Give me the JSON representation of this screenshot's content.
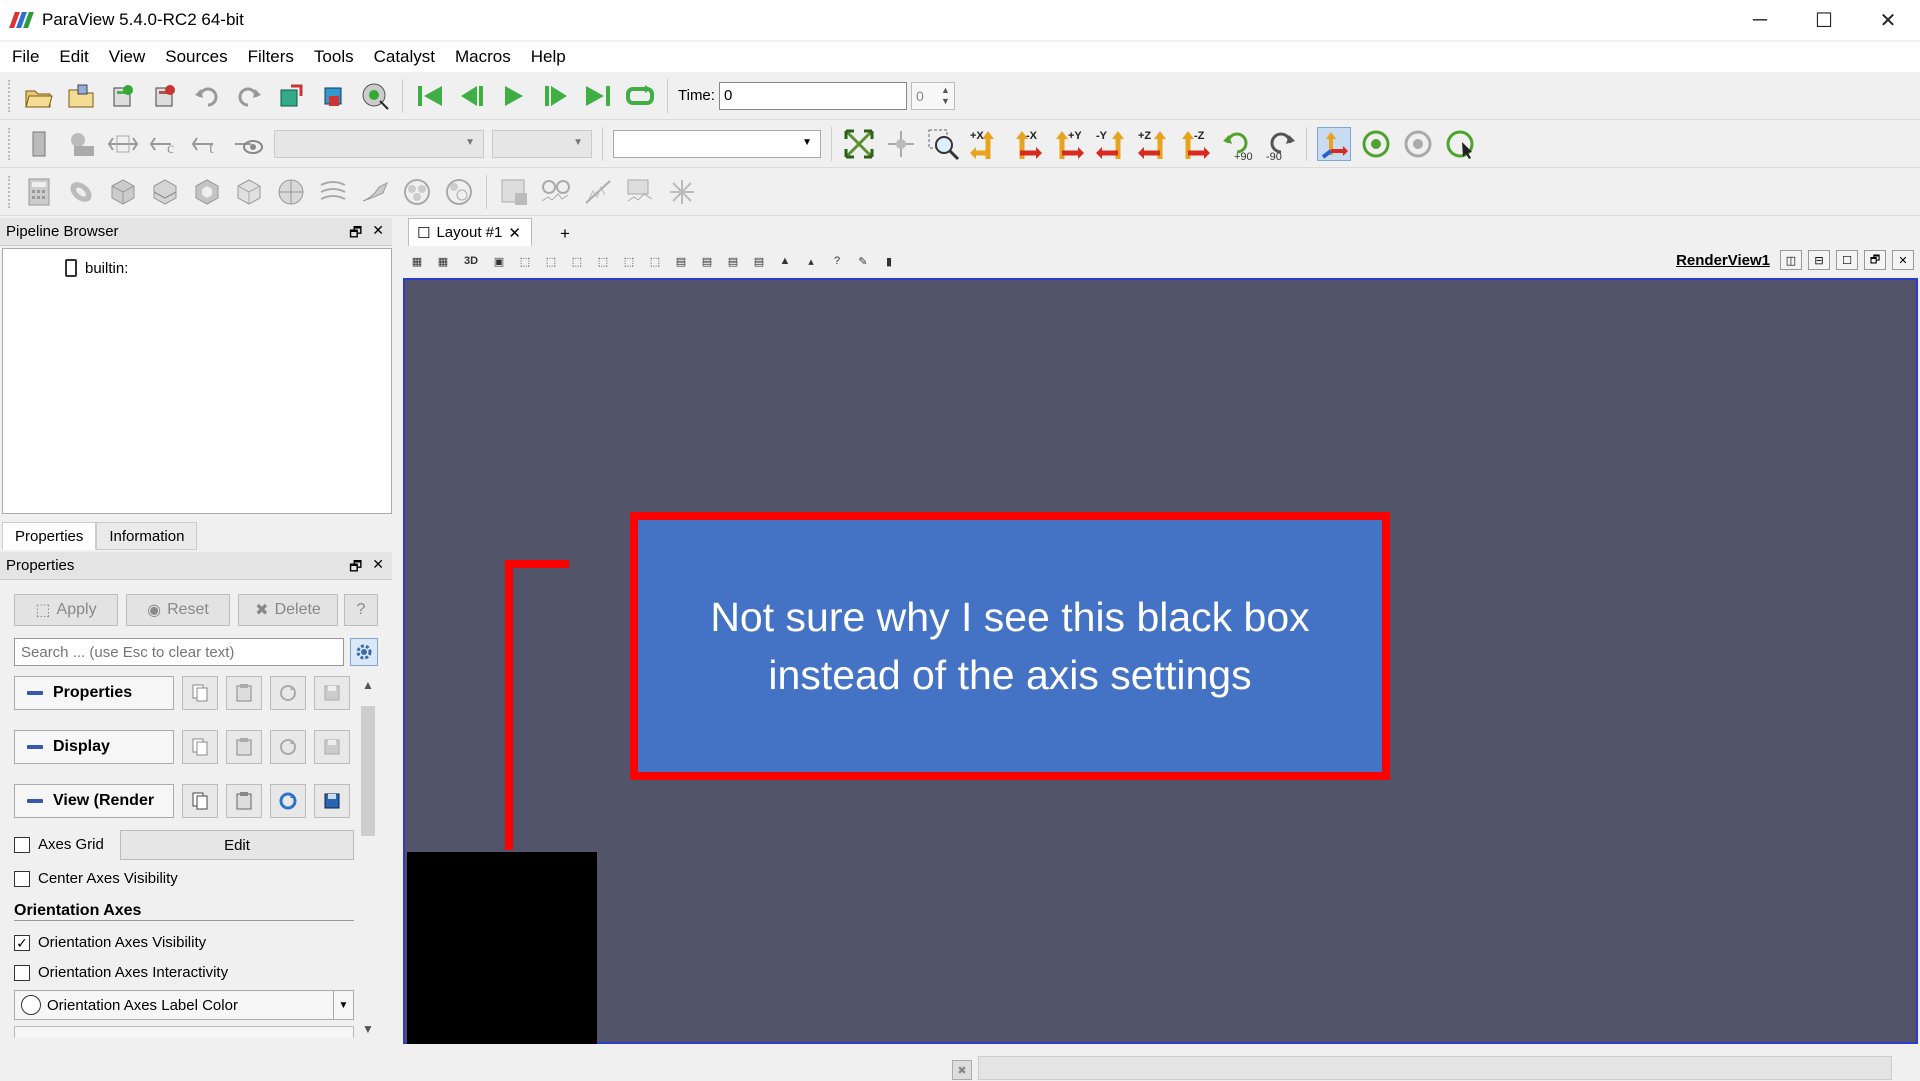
{
  "window": {
    "title": "ParaView 5.4.0-RC2 64-bit",
    "minimize": "─",
    "maximize": "☐",
    "close": "✕"
  },
  "menu": [
    "File",
    "Edit",
    "View",
    "Sources",
    "Filters",
    "Tools",
    "Catalyst",
    "Macros",
    "Help"
  ],
  "toolbar": {
    "time_label": "Time:",
    "time_value": "0",
    "timestep_value": "0",
    "axis_buttons": [
      "+X",
      "-X",
      "+Y",
      "-Y",
      "+Z",
      "-Z"
    ],
    "rotate_pos": "+90",
    "rotate_neg": "-90"
  },
  "pipeline_browser": {
    "title": "Pipeline Browser",
    "items": [
      "builtin:"
    ]
  },
  "left_tabs": [
    "Properties",
    "Information"
  ],
  "properties_panel": {
    "title": "Properties",
    "apply": "Apply",
    "reset": "Reset",
    "delete": "Delete",
    "help": "?",
    "search_placeholder": "Search ... (use Esc to clear text)",
    "sections": [
      "Properties",
      "Display",
      "View (Render"
    ],
    "axes_grid_label": "Axes Grid",
    "axes_grid_edit": "Edit",
    "center_axes_visibility": "Center Axes Visibility",
    "orientation_axes_title": "Orientation Axes",
    "orientation_axes_visibility": "Orientation Axes Visibility",
    "orientation_axes_interactivity": "Orientation Axes Interactivity",
    "orientation_axes_label_color": "Orientation Axes Label Color",
    "checked": {
      "axes_grid": false,
      "center_axes_visibility": false,
      "orientation_axes_visibility": true,
      "orientation_axes_interactivity": false
    }
  },
  "layout": {
    "tab_label": "Layout #1",
    "add_tab": "+",
    "view_label": "RenderView1",
    "view_3d": "3D"
  },
  "annotation": {
    "text": "Not sure why I see this black box instead of the axis settings",
    "fill_color": "#4472c4",
    "border_color": "#ff0000"
  },
  "colors": {
    "render_bg": "#525469",
    "render_border": "#2e3bd0"
  }
}
